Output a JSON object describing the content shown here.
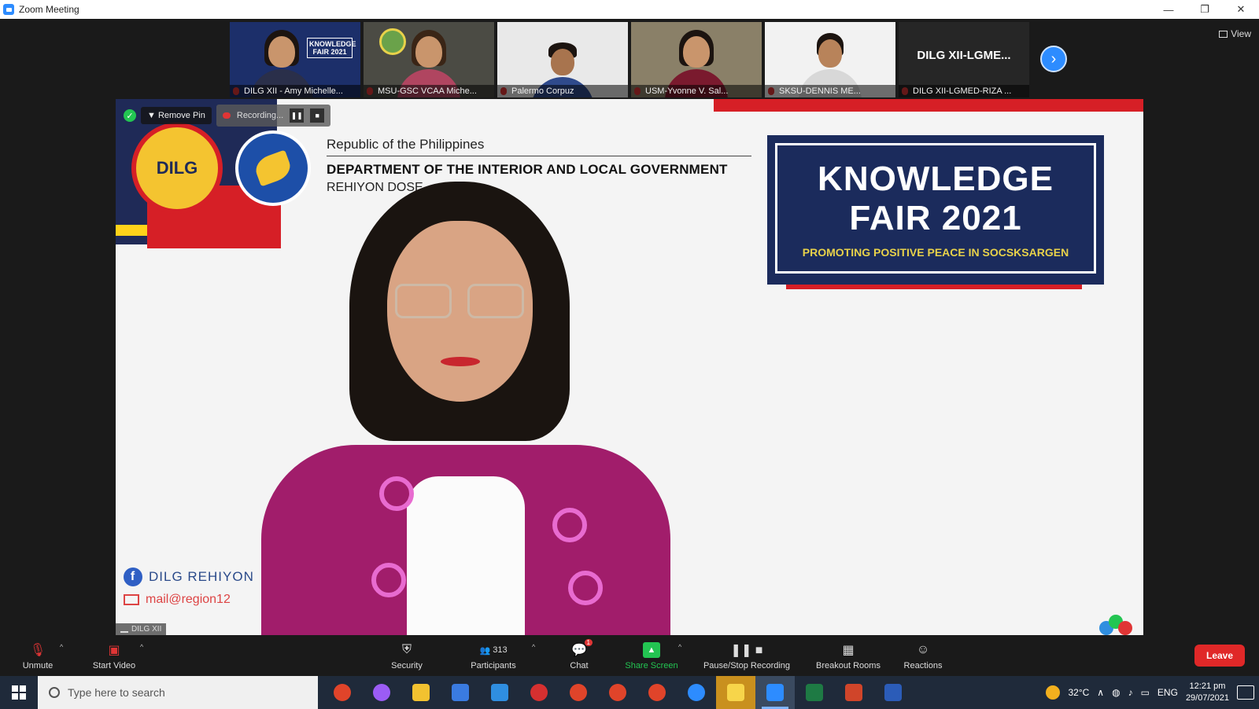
{
  "window": {
    "title": "Zoom Meeting",
    "controls": [
      "—",
      "❐",
      "✕"
    ]
  },
  "header": {
    "view_label": "View"
  },
  "participants": [
    {
      "name": "DILG XII - Amy Michelle...",
      "slide_text": "KNOWLEDGE FAIR 2021"
    },
    {
      "name": "MSU-GSC VCAA Miche..."
    },
    {
      "name": "Palermo Corpuz"
    },
    {
      "name": "USM-Yvonne V. Sal..."
    },
    {
      "name": "SKSU-DENNIS ME..."
    },
    {
      "name": "DILG XII-LGMED-RIZA ...",
      "display_text": "DILG XII-LGME..."
    }
  ],
  "pin_bar": {
    "remove_pin": "Remove Pin",
    "recording": "Recording...",
    "pause_icon": "❚❚",
    "stop_icon": "■"
  },
  "slide": {
    "seal_text": "DILG",
    "republic": "Republic of the Philippines",
    "department": "DEPARTMENT OF THE INTERIOR AND LOCAL GOVERNMENT",
    "region": "REHIYON DOSE",
    "kf_line1": "KNOWLEDGE",
    "kf_line2": "FAIR 2021",
    "kf_tagline": "PROMOTING POSITIVE PEACE IN SOCSKSARGEN",
    "fb_text": "DILG REHIYON",
    "mail_text": "mail@region12",
    "speaker_label": "DILG XII"
  },
  "toolbar": {
    "unmute": "Unmute",
    "start_video": "Start Video",
    "security": "Security",
    "participants": "Participants",
    "participants_count": "313",
    "chat": "Chat",
    "chat_badge": "1",
    "share_screen": "Share Screen",
    "pause_stop": "Pause/Stop Recording",
    "breakout": "Breakout Rooms",
    "reactions": "Reactions",
    "leave": "Leave"
  },
  "taskbar": {
    "search_placeholder": "Type here to search",
    "temperature": "32°C",
    "language": "ENG",
    "time": "12:21 pm",
    "date": "29/07/2021"
  },
  "colors": {
    "zoom_blue": "#2d8cff",
    "leave_red": "#e02828",
    "share_green": "#23c552",
    "dilg_navy": "#1b2b5c",
    "dilg_red": "#d61f26"
  }
}
